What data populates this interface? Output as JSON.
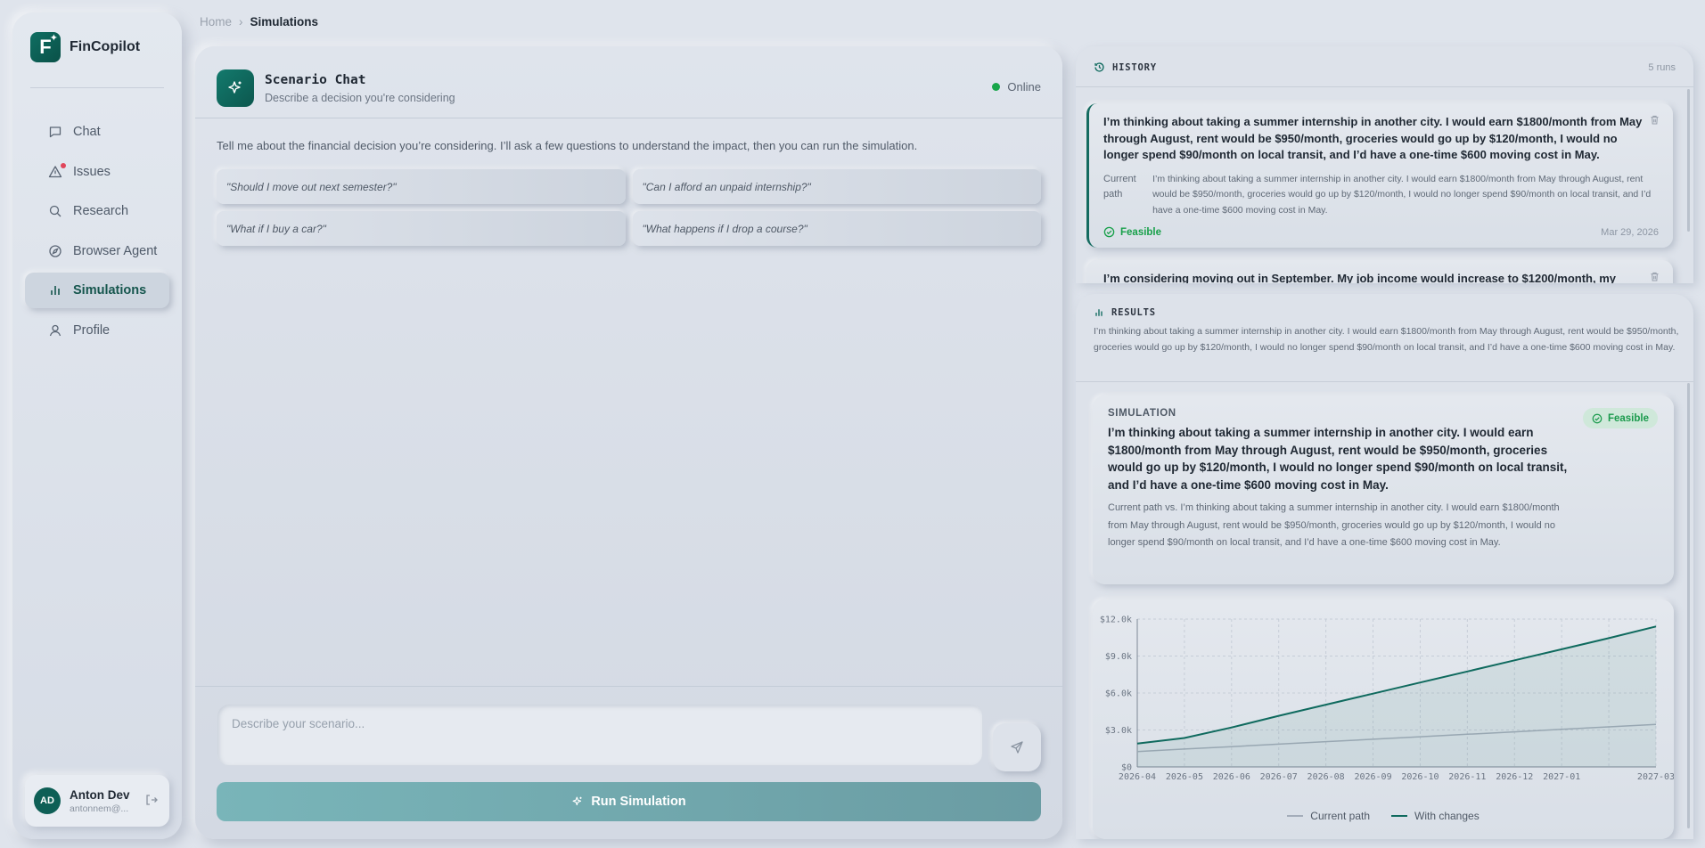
{
  "brand": {
    "name": "FinCopilot",
    "logo_letter": "F"
  },
  "nav": [
    {
      "label": "Chat",
      "icon": "chat-icon"
    },
    {
      "label": "Issues",
      "icon": "alert-icon"
    },
    {
      "label": "Research",
      "icon": "search-icon"
    },
    {
      "label": "Browser Agent",
      "icon": "compass-icon"
    },
    {
      "label": "Simulations",
      "icon": "bar-chart-icon"
    },
    {
      "label": "Profile",
      "icon": "user-icon"
    }
  ],
  "user": {
    "initials": "AD",
    "name": "Anton Dev",
    "email": "antonnem@..."
  },
  "breadcrumb": {
    "home": "Home",
    "separator": "›",
    "current": "Simulations"
  },
  "chat": {
    "title": "Scenario Chat",
    "subtitle": "Describe a decision you're considering",
    "status": "Online",
    "intro": "Tell me about the financial decision you’re considering. I’ll ask a few questions to understand the impact, then you can run the simulation.",
    "suggestions": [
      "\"Should I move out next semester?\"",
      "\"Can I afford an unpaid internship?\"",
      "\"What if I buy a car?\"",
      "\"What happens if I drop a course?\""
    ],
    "input_placeholder": "Describe your scenario...",
    "run_label": "Run Simulation"
  },
  "history": {
    "heading": "HISTORY",
    "count": "5 runs",
    "items": [
      {
        "title": "I’m thinking about taking a summer internship in another city. I would earn $1800/month from May through August, rent would be $950/month, groceries would go up by $120/month, I would no longer spend $90/month on local transit, and I’d have a one-time $600 moving cost in May.",
        "label": "Current path",
        "desc": "I’m thinking about taking a summer internship in another city. I would earn $1800/month from May through August, rent would be $950/month, groceries would go up by $120/month, I would no longer spend $90/month on local transit, and I’d have a one-time $600 moving cost in May.",
        "status": "Feasible",
        "date": "Mar 29, 2026"
      },
      {
        "title": "I’m considering moving out in September. My job income would increase to $1200/month, my"
      }
    ]
  },
  "results": {
    "heading": "RESULTS",
    "subtitle": "I’m thinking about taking a summer internship in another city. I would earn $1800/month from May through August, rent would be $950/month, groceries would go up by $120/month, I would no longer spend $90/month on local transit, and I’d have a one-time $600 moving cost in May.",
    "simulation": {
      "label": "SIMULATION",
      "badge": "Feasible",
      "title": "I’m thinking about taking a summer internship in another city. I would earn $1800/month from May through August, rent would be $950/month, groceries would go up by $120/month, I would no longer spend $90/month on local transit, and I’d have a one-time $600 moving cost in May.",
      "desc": "Current path vs. I’m thinking about taking a summer internship in another city. I would earn $1800/month from May through August, rent would be $950/month, groceries would go up by $120/month, I would no longer spend $90/month on local transit, and I’d have a one-time $600 moving cost in May."
    }
  },
  "chart_data": {
    "type": "line",
    "x": [
      "2026-04",
      "2026-05",
      "2026-06",
      "2026-07",
      "2026-08",
      "2026-09",
      "2026-10",
      "2026-11",
      "2026-12",
      "2027-01",
      "2027-02",
      "2027-03"
    ],
    "x_tick_labels": [
      "2026-04",
      "2026-05",
      "2026-06",
      "2026-07",
      "2026-08",
      "2026-09",
      "2026-10",
      "2026-11",
      "2026-12",
      "2027-01",
      "",
      "2027-03"
    ],
    "ylim": [
      0,
      12000
    ],
    "y_ticks": [
      0,
      3000,
      6000,
      9000,
      12000
    ],
    "y_tick_labels": [
      "$0",
      "$3.0k",
      "$6.0k",
      "$9.0k",
      "$12.0k"
    ],
    "grid": true,
    "legend": "bottom",
    "series": [
      {
        "name": "Current path",
        "color": "#a4adba",
        "values": [
          1250,
          1450,
          1650,
          1850,
          2050,
          2250,
          2450,
          2650,
          2850,
          3050,
          3250,
          3450
        ]
      },
      {
        "name": "With changes",
        "color": "#0f6a5e",
        "values": [
          1900,
          2350,
          3200,
          4150,
          5050,
          5950,
          6850,
          7750,
          8650,
          9550,
          10450,
          11400
        ]
      }
    ]
  }
}
